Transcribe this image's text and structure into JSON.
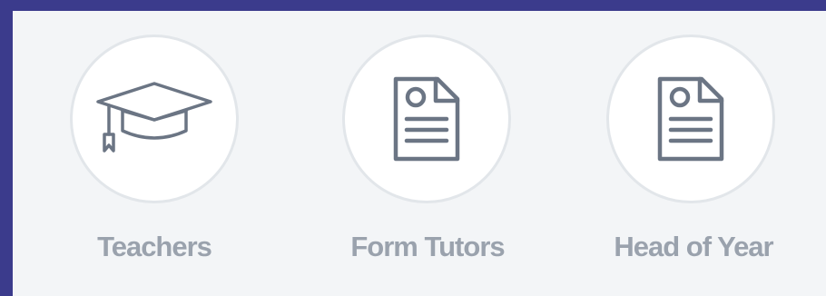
{
  "items": [
    {
      "label": "Teachers",
      "icon": "graduation-cap-icon"
    },
    {
      "label": "Form Tutors",
      "icon": "document-icon"
    },
    {
      "label": "Head of Year",
      "icon": "document-icon"
    }
  ],
  "colors": {
    "frame": "#3b3b8c",
    "panel": "#f3f5f7",
    "icon": "#6b7584",
    "label": "#9aa2ad",
    "circle_border": "#e2e6ea"
  }
}
